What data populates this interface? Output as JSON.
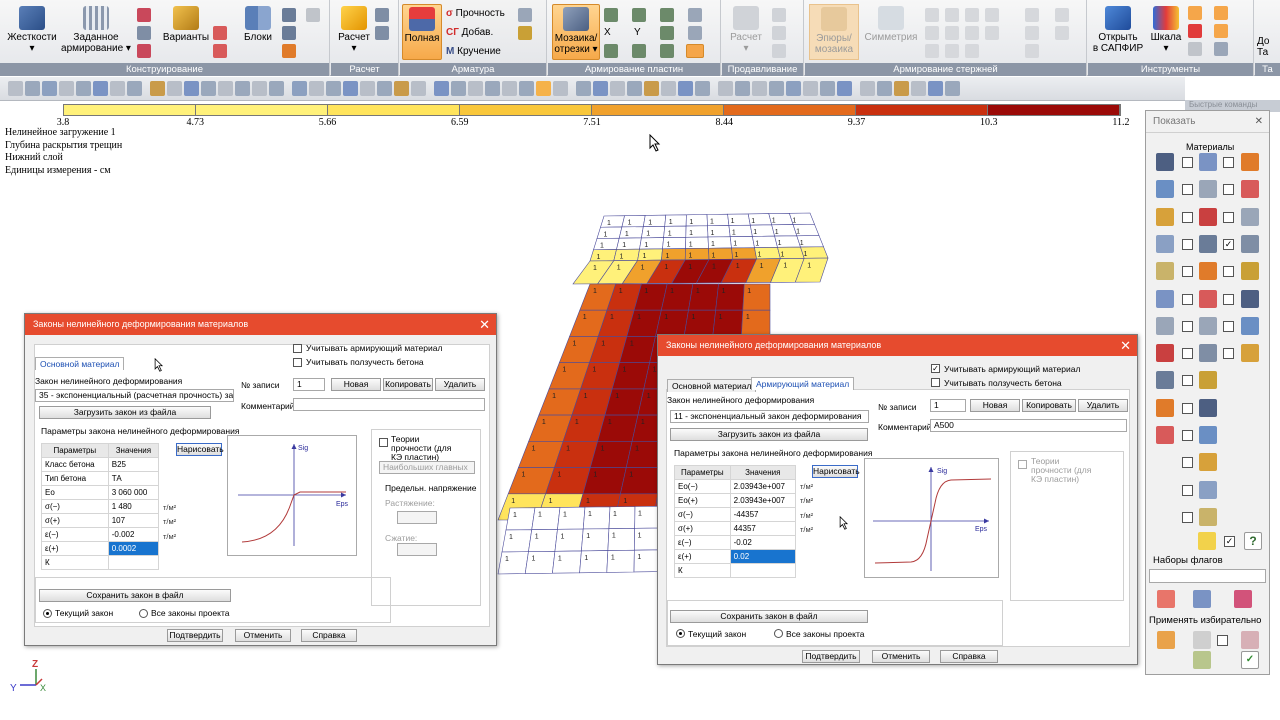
{
  "ribbon": {
    "groups": [
      {
        "label": "Конструирование"
      },
      {
        "label": "Расчет"
      },
      {
        "label": "Арматура"
      },
      {
        "label": "Армирование пластин"
      },
      {
        "label": "Продавливание"
      },
      {
        "label": "Армирование стержней"
      },
      {
        "label": "Инструменты"
      },
      {
        "label": "Та"
      }
    ],
    "buttons": {
      "stiffness": "Жесткости",
      "specified_reinf_1": "Заданное",
      "specified_reinf_2": "армирование",
      "variants": "Варианты",
      "blocks": "Блоки",
      "calc": "Расчет",
      "full": "Полная",
      "strength": "Прочность",
      "added": "Добав.",
      "torsion": "Кручение",
      "mosaic_1": "Мозаика/",
      "mosaic_2": "отрезки",
      "x": "X",
      "y": "Y",
      "punch_calc": "Расчет",
      "diagrams_1": "Эпюры/",
      "diagrams_2": "мозаика",
      "symmetry": "Симметрия",
      "open_1": "Открыть",
      "open_2": "в САПФИР",
      "scale_1": "Шкала",
      "do_1": "До",
      "do_2": "Та"
    },
    "prefixes": {
      "sigma": "σ",
      "sg": "СГ",
      "m": "М"
    }
  },
  "scale": {
    "ticks": [
      "3.8",
      "4.73",
      "5.66",
      "6.59",
      "7.51",
      "8.44",
      "9.37",
      "10.3",
      "11.2"
    ],
    "colors": [
      "#fff17a",
      "#fff17a",
      "#ffe45c",
      "#f9c73a",
      "#f0a12c",
      "#e36a1c",
      "#c9300f",
      "#9b0a07"
    ]
  },
  "info_lines": [
    "Нелинейное загружение 1",
    "Глубина раскрытия трещин",
    "Нижний слой",
    "Единицы измерения - см"
  ],
  "mesh": {
    "cell_value": "1"
  },
  "dialog1": {
    "title": "Законы нелинейного деформирования материалов",
    "tab_main": "Основной материал",
    "chk_reinf": "Учитывать армирующий материал",
    "chk_creep": "Учитывать ползучесть бетона",
    "law_label": "Закон нелинейного деформирования",
    "law_value": "35 - экспоненциальный (расчетная прочность) за",
    "load_btn": "Загрузить закон из файла",
    "params_title": "Параметры закона нелинейного деформирования",
    "col_params": "Параметры",
    "col_values": "Значения",
    "rows": [
      {
        "p": "Класс бетона",
        "v": "B25",
        "u": ""
      },
      {
        "p": "Тип бетона",
        "v": "ТА",
        "u": ""
      },
      {
        "p": "Eo",
        "v": "3 060 000",
        "u": "т/м²"
      },
      {
        "p": "σ(−)",
        "v": "1 480",
        "u": "т/м²"
      },
      {
        "p": "σ(+)",
        "v": "107",
        "u": "т/м²"
      },
      {
        "p": "ε(−)",
        "v": "-0.002",
        "u": ""
      },
      {
        "p": "ε(+)",
        "v": "0.0002",
        "u": ""
      },
      {
        "p": "К",
        "v": "",
        "u": ""
      }
    ],
    "draw_btn": "Нарисовать",
    "graph_y": "Sig",
    "graph_x": "Eps",
    "record_label": "№ записи",
    "record_value": "1",
    "new_btn": "Новая",
    "copy_btn": "Копировать",
    "delete_btn": "Удалить",
    "comment_label": "Комментарий",
    "comment_value": "",
    "theory_chk": "Теории прочности (для КЭ пластин)",
    "main_stress_select": "Наибольших главных",
    "limit_stress": "Предельн. напряжение",
    "tension": "Растяжение:",
    "compression": "Сжатие:",
    "save_btn": "Сохранить закон в файл",
    "radio_current": "Текущий закон",
    "radio_all": "Все законы проекта",
    "ok_btn": "Подтвердить",
    "cancel_btn": "Отменить",
    "help_btn": "Справка"
  },
  "dialog2": {
    "title": "Законы нелинейного деформирования материалов",
    "tab_main": "Основной материал",
    "tab_reinf": "Армирующий материал",
    "chk_reinf": "Учитывать армирующий материал",
    "chk_creep": "Учитывать ползучесть бетона",
    "law_label": "Закон нелинейного деформирования",
    "law_value": "11 - экспоненциальный закон деформирования",
    "load_btn": "Загрузить закон из файла",
    "params_title": "Параметры закона нелинейного деформирования",
    "col_params": "Параметры",
    "col_values": "Значения",
    "rows": [
      {
        "p": "Eo(−)",
        "v": "2.03943e+007",
        "u": "т/м²"
      },
      {
        "p": "Eo(+)",
        "v": "2.03943e+007",
        "u": "т/м²"
      },
      {
        "p": "σ(−)",
        "v": "-44357",
        "u": "т/м²"
      },
      {
        "p": "σ(+)",
        "v": "44357",
        "u": "т/м²"
      },
      {
        "p": "ε(−)",
        "v": "-0.02",
        "u": ""
      },
      {
        "p": "ε(+)",
        "v": "0.02",
        "u": ""
      },
      {
        "p": "К",
        "v": "",
        "u": ""
      }
    ],
    "draw_btn": "Нарисовать",
    "graph_y": "Sig",
    "graph_x": "Eps",
    "record_label": "№ записи",
    "record_value": "1",
    "new_btn": "Новая",
    "copy_btn": "Копировать",
    "delete_btn": "Удалить",
    "comment_label": "Комментарий",
    "comment_value": "A500",
    "theory_chk": "Теории прочности (для КЭ пластин)",
    "save_btn": "Сохранить закон в файл",
    "radio_current": "Текущий закон",
    "radio_all": "Все законы проекта",
    "ok_btn": "Подтвердить",
    "cancel_btn": "Отменить",
    "help_btn": "Справка"
  },
  "right_panel": {
    "title": "Показать",
    "materials": "Материалы",
    "flag_sets": "Наборы флагов",
    "apply_selective": "Применять избирательно",
    "behind_tab": "Быстрые команды"
  },
  "axes": {
    "z": "Z",
    "y": "Y",
    "x": "X"
  }
}
